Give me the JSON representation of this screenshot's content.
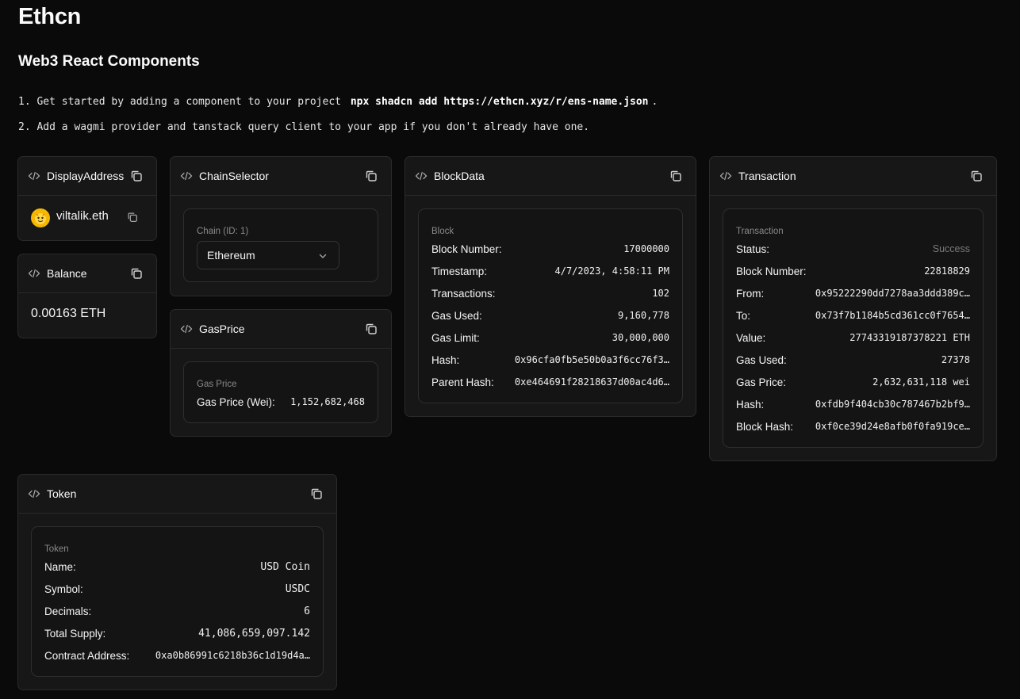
{
  "header": {
    "title": "Ethcn",
    "subtitle": "Web3 React Components",
    "step1_text": "1. Get started by adding a component to your project",
    "step1_code": "npx shadcn add https://ethcn.xyz/r/ens-name.json",
    "step1_end": ".",
    "step2_text": "2. Add a wagmi provider and tanstack query client to your app if you don't already have one."
  },
  "display_address": {
    "title": "DisplayAddress",
    "name": "viltalik.eth",
    "avatar_icon": "emoji-avatar-icon"
  },
  "balance": {
    "title": "Balance",
    "value": "0.00163 ETH"
  },
  "chain_selector": {
    "title": "ChainSelector",
    "label": "Chain (ID: 1)",
    "selected": "Ethereum"
  },
  "gas_price": {
    "title": "GasPrice",
    "label": "Gas Price",
    "row_key": "Gas Price (Wei):",
    "row_value": "1,152,682,468"
  },
  "block_data": {
    "title": "BlockData",
    "label": "Block",
    "rows": [
      {
        "k": "Block Number:",
        "v": "17000000"
      },
      {
        "k": "Timestamp:",
        "v": "4/7/2023, 4:58:11 PM"
      },
      {
        "k": "Transactions:",
        "v": "102"
      },
      {
        "k": "Gas Used:",
        "v": "9,160,778"
      },
      {
        "k": "Gas Limit:",
        "v": "30,000,000"
      },
      {
        "k": "Hash:",
        "v": "0x96cfa0fb5e50b0a3f6cc76f3…"
      },
      {
        "k": "Parent Hash:",
        "v": "0xe464691f28218637d00ac4d6…"
      }
    ]
  },
  "transaction": {
    "title": "Transaction",
    "label": "Transaction",
    "rows": [
      {
        "k": "Status:",
        "v": "Success"
      },
      {
        "k": "Block Number:",
        "v": "22818829"
      },
      {
        "k": "From:",
        "v": "0x95222290dd7278aa3ddd389c…"
      },
      {
        "k": "To:",
        "v": "0x73f7b1184b5cd361cc0f7654…"
      },
      {
        "k": "Value:",
        "v": "27743319187378221 ETH"
      },
      {
        "k": "Gas Used:",
        "v": "27378"
      },
      {
        "k": "Gas Price:",
        "v": "2,632,631,118 wei"
      },
      {
        "k": "Hash:",
        "v": "0xfdb9f404cb30c787467b2bf9…"
      },
      {
        "k": "Block Hash:",
        "v": "0xf0ce39d24e8afb0f0fa919ce…"
      }
    ]
  },
  "token": {
    "title": "Token",
    "label": "Token",
    "rows": [
      {
        "k": "Name:",
        "v": "USD Coin"
      },
      {
        "k": "Symbol:",
        "v": "USDC"
      },
      {
        "k": "Decimals:",
        "v": "6"
      },
      {
        "k": "Total Supply:",
        "v": "41,086,659,097.142"
      },
      {
        "k": "Contract Address:",
        "v": "0xa0b86991c6218b36c1d19d4a…"
      }
    ]
  }
}
